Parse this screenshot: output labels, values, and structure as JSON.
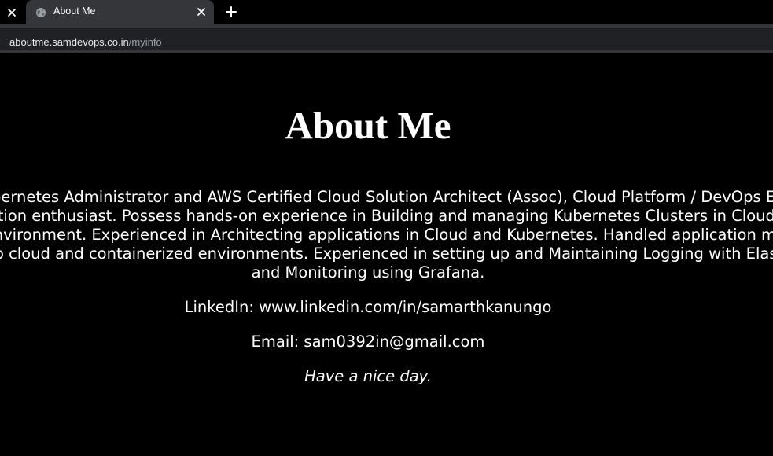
{
  "browser": {
    "tab": {
      "title": "About Me",
      "favicon": "globe-icon"
    },
    "address_bar": {
      "host": "aboutme.samdevops.co.in",
      "path": "/myinfo"
    },
    "colors": {
      "tabstrip": "#000000",
      "toolbar": "#35363a",
      "omnibox": "#202124"
    }
  },
  "page": {
    "title": "About Me",
    "bio_lines": [
      "Certified Kubernetes Administrator and AWS Certified Cloud Solution Architect (Assoc), Cloud Platform / DevOps Engineer",
      "and an automation enthusiast. Possess hands-on experience in Building and managing Kubernetes Clusters in Cloud as well as",
      "on-premise environment. Experienced in Architecting applications in Cloud and Kubernetes. Handled application migrations",
      "from legacy to cloud and containerized environments. Experienced in setting up and Maintaining Logging with Elastic Stack",
      "and Monitoring using Grafana."
    ],
    "linkedin": "LinkedIn: www.linkedin.com/in/samarthkanungo",
    "email": "Email: sam0392in@gmail.com",
    "signoff": "Have a nice day.",
    "colors": {
      "background": "#000000",
      "text": "#ffffff"
    }
  }
}
